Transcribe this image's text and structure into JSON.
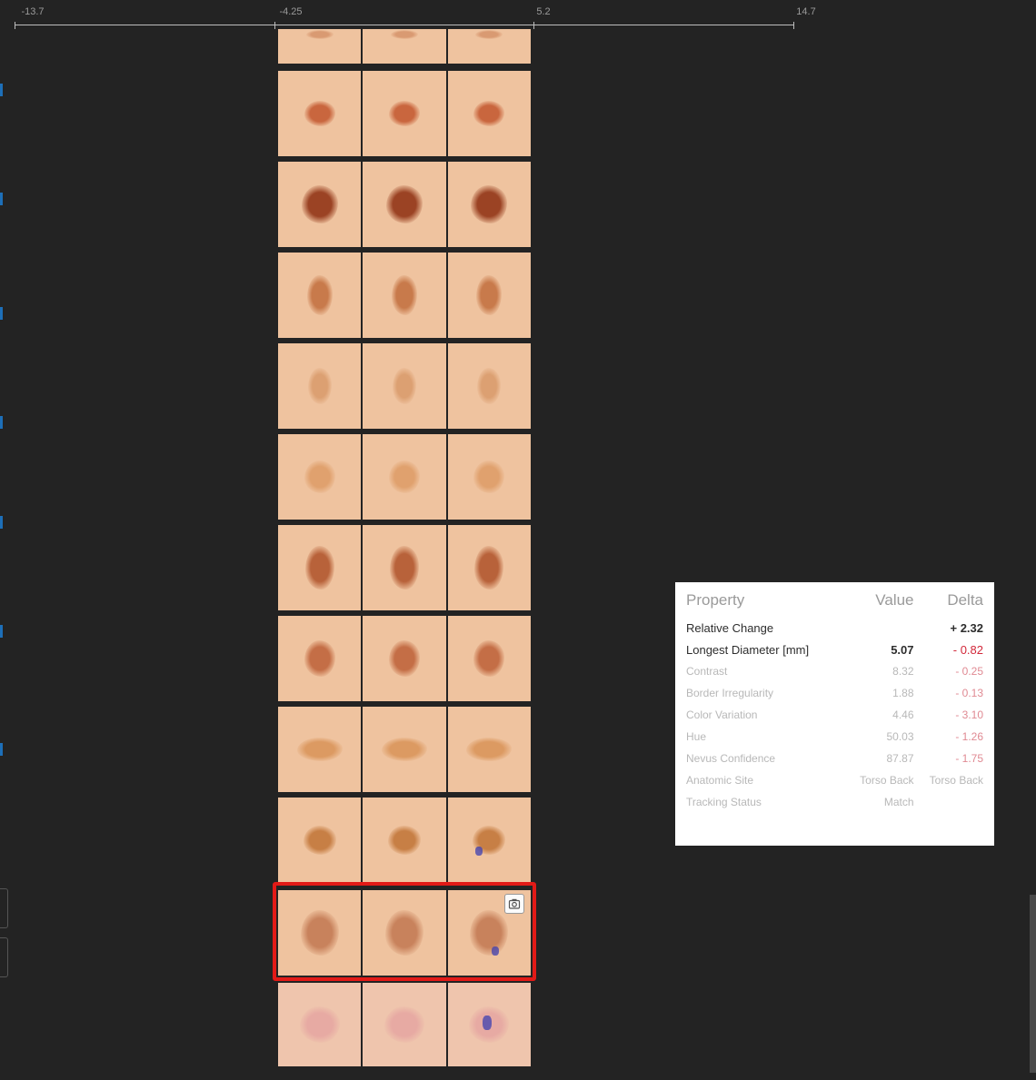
{
  "ruler": {
    "ticks": [
      "-13.7",
      "-4.25",
      "5.2",
      "14.7"
    ]
  },
  "lesion_strip": {
    "rows": 12,
    "selected_row": 11
  },
  "properties_panel": {
    "headers": {
      "property": "Property",
      "value": "Value",
      "delta": "Delta"
    },
    "rows": [
      {
        "property": "Relative Change",
        "value": "",
        "delta": "+ 2.32"
      },
      {
        "property": "Longest Diameter [mm]",
        "value": "5.07",
        "delta": "- 0.82"
      },
      {
        "property": "Contrast",
        "value": "8.32",
        "delta": "- 0.25"
      },
      {
        "property": "Border Irregularity",
        "value": "1.88",
        "delta": "- 0.13"
      },
      {
        "property": "Color Variation",
        "value": "4.46",
        "delta": "- 3.10"
      },
      {
        "property": "Hue",
        "value": "50.03",
        "delta": "- 1.26"
      },
      {
        "property": "Nevus Confidence",
        "value": "87.87",
        "delta": "- 1.75"
      },
      {
        "property": "Anatomic Site",
        "value": "Torso Back",
        "delta": "Torso Back"
      },
      {
        "property": "Tracking Status",
        "value": "Match",
        "delta": ""
      }
    ]
  },
  "colors": {
    "background": "#232323",
    "selection": "#e21a17",
    "negative_delta": "#d2283a"
  }
}
